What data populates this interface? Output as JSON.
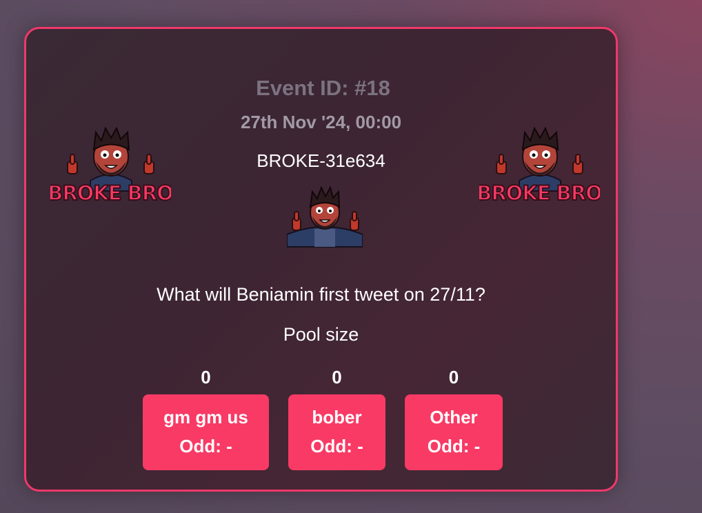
{
  "event": {
    "id_label": "Event ID: #18",
    "date": "27th Nov '24, 00:00",
    "ticker": "BROKE-31e634",
    "question": "What will Beniamin first tweet on 27/11?",
    "pool_label": "Pool size"
  },
  "logo": {
    "text": "BROKE BRO"
  },
  "options": [
    {
      "label": "gm gm us",
      "odd": "Odd: -",
      "pool": "0"
    },
    {
      "label": "bober",
      "odd": "Odd: -",
      "pool": "0"
    },
    {
      "label": "Other",
      "odd": "Odd: -",
      "pool": "0"
    }
  ],
  "colors": {
    "accent": "#f83a65",
    "border": "#f0386a",
    "muted_title": "#7c7380",
    "muted_date": "#a29aa6"
  }
}
